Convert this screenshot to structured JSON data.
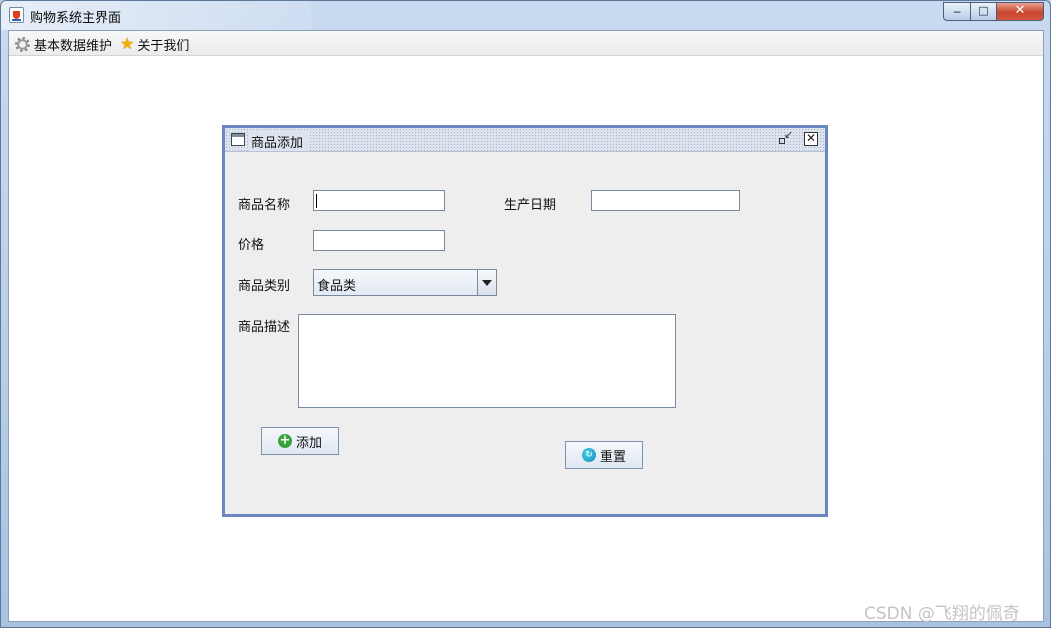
{
  "window": {
    "title": "购物系统主界面",
    "controls": {
      "minimize": "─",
      "maximize": "□",
      "close": "✕"
    }
  },
  "menubar": {
    "items": [
      {
        "label": "基本数据维护",
        "icon": "gear-icon"
      },
      {
        "label": "关于我们",
        "icon": "star-icon"
      }
    ]
  },
  "internal_frame": {
    "title": "商品添加",
    "close_glyph": "✕",
    "form": {
      "name_label": "商品名称",
      "name_value": "",
      "date_label": "生产日期",
      "date_value": "",
      "price_label": "价格",
      "price_value": "",
      "category_label": "商品类别",
      "category_selected": "食品类",
      "desc_label": "商品描述",
      "desc_value": ""
    },
    "buttons": {
      "add": {
        "label": "添加",
        "icon": "plus-circle-icon",
        "glyph": "+"
      },
      "reset": {
        "label": "重置",
        "icon": "reset-icon",
        "glyph": "↻"
      }
    }
  },
  "watermark": "CSDN @飞翔的佩奇"
}
